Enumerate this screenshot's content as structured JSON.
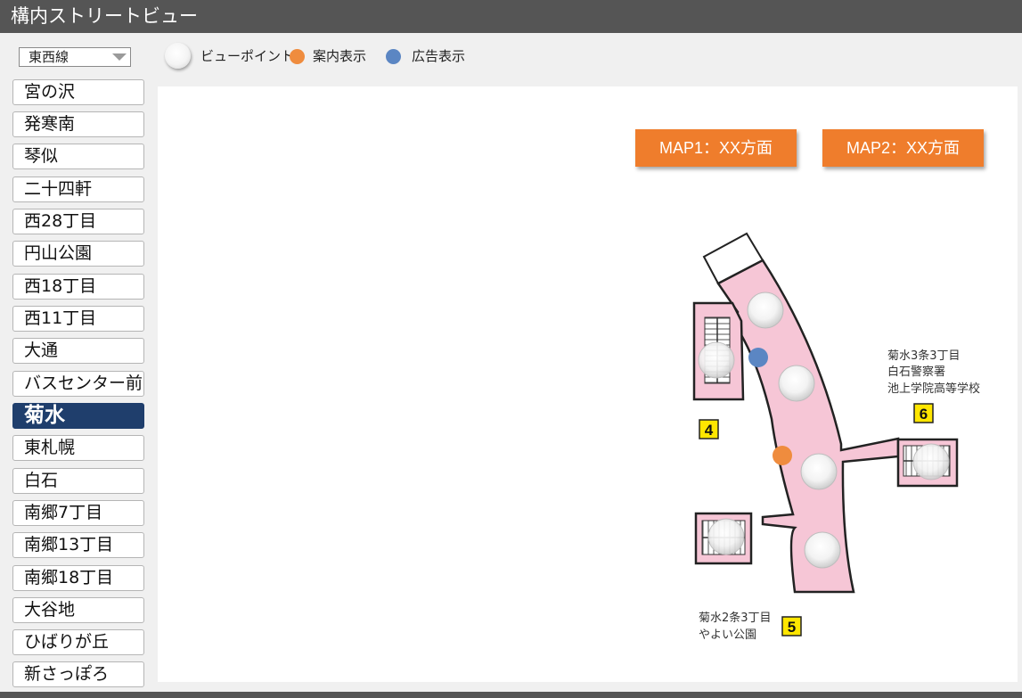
{
  "window": {
    "title": "構内ストリートビュー"
  },
  "line_select": {
    "value": "東西線"
  },
  "legend": {
    "viewpoint_label": "ビューポイント",
    "guide_label": "案内表示",
    "ad_label": "広告表示",
    "guide_color": "#ef8c3e",
    "ad_color": "#5b86c3"
  },
  "stations": [
    {
      "name": "宮の沢"
    },
    {
      "name": "発寒南"
    },
    {
      "name": "琴似"
    },
    {
      "name": "二十四軒"
    },
    {
      "name": "西28丁目"
    },
    {
      "name": "円山公園"
    },
    {
      "name": "西18丁目"
    },
    {
      "name": "西11丁目"
    },
    {
      "name": "大通"
    },
    {
      "name": "バスセンター前"
    },
    {
      "name": "菊水"
    },
    {
      "name": "東札幌"
    },
    {
      "name": "白石"
    },
    {
      "name": "南郷7丁目"
    },
    {
      "name": "南郷13丁目"
    },
    {
      "name": "南郷18丁目"
    },
    {
      "name": "大谷地"
    },
    {
      "name": "ひばりが丘"
    },
    {
      "name": "新さっぽろ"
    }
  ],
  "active_station": "菊水",
  "map": {
    "btn1": "MAP1：XX方面",
    "btn2": "MAP2：XX方面",
    "exit4": {
      "number": "4"
    },
    "exit5": {
      "number": "5",
      "line1": "菊水2条3丁目",
      "line2": "やよい公園"
    },
    "exit6": {
      "number": "6",
      "line1": "菊水3条3丁目",
      "line2": "白石警察署",
      "line3": "池上学院高等学校"
    },
    "corridor_color": "#f6c6d6",
    "button_color": "#ef7d2c"
  }
}
